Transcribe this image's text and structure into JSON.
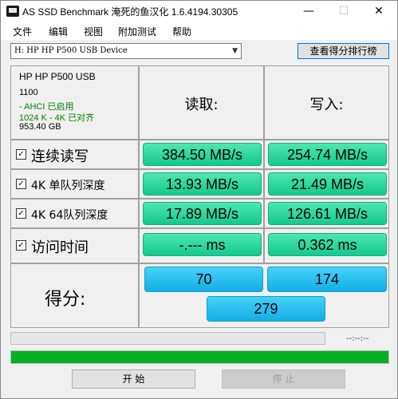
{
  "window": {
    "title": "AS SSD Benchmark 淹死的鱼汉化 1.6.4194.30305",
    "minimize": "—",
    "maximize": "☐",
    "close": "✕"
  },
  "menu": [
    "文件",
    "编辑",
    "视图",
    "附加测试",
    "帮助"
  ],
  "device": {
    "selected": "H: HP HP P500 USB Device",
    "rank_button": "查看得分排行榜"
  },
  "info": {
    "name": "HP HP P500 USB",
    "firmware": "1100",
    "ahci": "- AHCI 已启用",
    "align": "1024 K - 4K 已对齐",
    "size": "953.40 GB"
  },
  "headers": {
    "read": "读取:",
    "write": "写入:"
  },
  "rows": [
    {
      "label": "连续读写",
      "read": "384.50 MB/s",
      "write": "254.74 MB/s",
      "checked": true
    },
    {
      "label": "4K 单队列深度",
      "read": "13.93 MB/s",
      "write": "21.49 MB/s",
      "checked": true
    },
    {
      "label": "4K 64队列深度",
      "read": "17.89 MB/s",
      "write": "126.61 MB/s",
      "checked": true
    },
    {
      "label": "访问时间",
      "read": "-.--- ms",
      "write": "0.362 ms",
      "checked": true
    }
  ],
  "score": {
    "label": "得分:",
    "read": "70",
    "write": "174",
    "total": "279"
  },
  "progress": {
    "time": "--:--:--",
    "main_fraction": 1.0
  },
  "buttons": {
    "start": "开  始",
    "stop": "停  止"
  },
  "colors": {
    "green_bar": "#14c98d",
    "blue_bar": "#13aee6",
    "progress": "#06b025"
  }
}
